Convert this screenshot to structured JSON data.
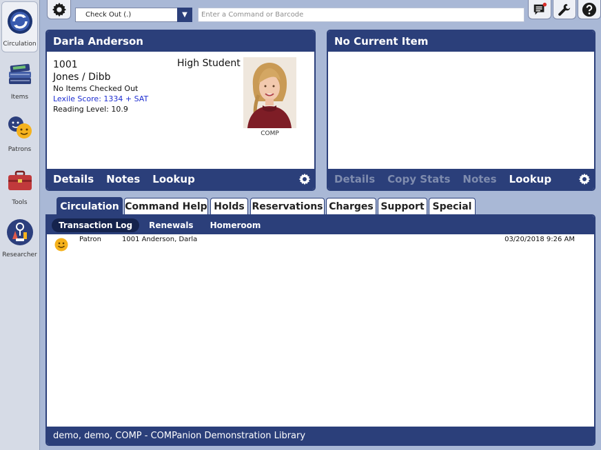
{
  "sidebar": {
    "items": [
      {
        "label": "Circulation",
        "icon": "circulation-icon"
      },
      {
        "label": "Items",
        "icon": "books-icon"
      },
      {
        "label": "Patrons",
        "icon": "patrons-icon"
      },
      {
        "label": "Tools",
        "icon": "toolbox-icon"
      },
      {
        "label": "Researcher",
        "icon": "researcher-icon"
      }
    ]
  },
  "toolbar": {
    "mode": "Check Out (.)",
    "command_placeholder": "Enter a Command or Barcode"
  },
  "patron": {
    "name": "Darla Anderson",
    "barcode": "1001",
    "homeroom": "Jones / Dibb",
    "checkouts": "No Items Checked Out",
    "lexile": "Lexile Score: 1334 + SAT",
    "reading_level": "Reading Level: 10.9",
    "type": "High Student",
    "site": "COMP",
    "links": [
      "Details",
      "Notes",
      "Lookup"
    ]
  },
  "item_panel": {
    "title": "No Current Item",
    "links": [
      "Details",
      "Copy Stats",
      "Notes",
      "Lookup"
    ]
  },
  "tabs": [
    "Circulation",
    "Command Help",
    "Holds",
    "Reservations",
    "Charges",
    "Support",
    "Special"
  ],
  "subtabs": [
    "Transaction Log",
    "Renewals",
    "Homeroom"
  ],
  "log": [
    {
      "type": "Patron",
      "detail": "1001 Anderson, Darla",
      "timestamp": "03/20/2018 9:26 AM"
    }
  ],
  "status": "demo, demo, COMP - COMPanion Demonstration Library",
  "colors": {
    "navy": "#2b3f7a",
    "background": "#a9b8d6",
    "lexile": "#1c2cd0"
  }
}
